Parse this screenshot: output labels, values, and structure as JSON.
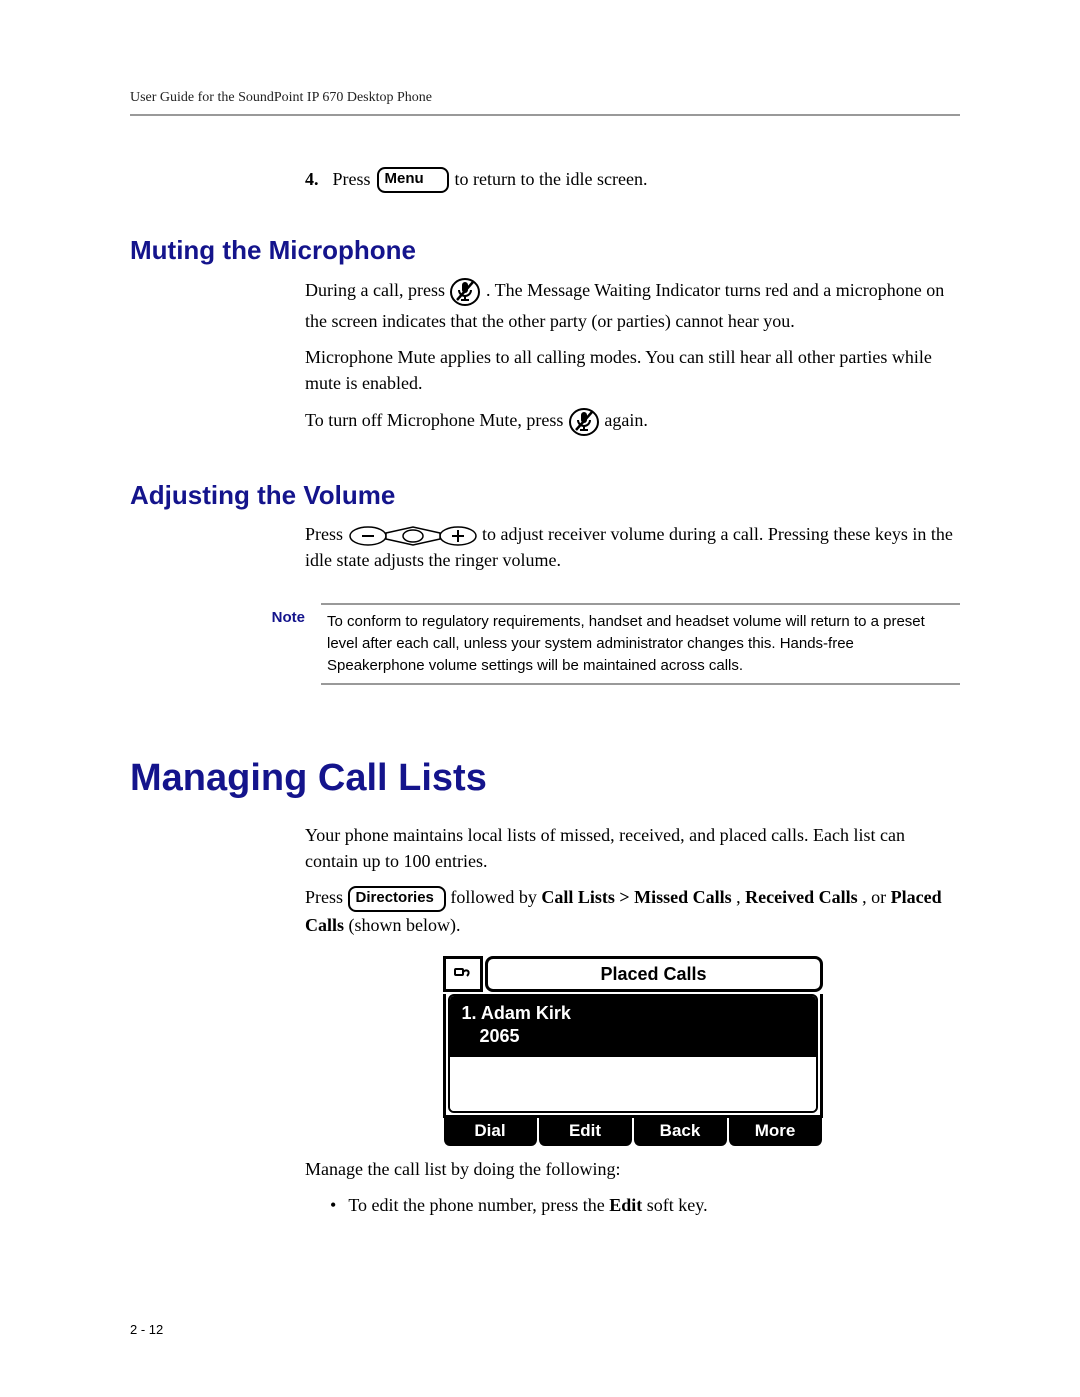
{
  "header": "User Guide for the SoundPoint IP 670 Desktop Phone",
  "step4": {
    "num": "4.",
    "t1": "Press",
    "btn": "Menu",
    "t2": "to return to the idle screen."
  },
  "sec_mute": {
    "title": "Muting the Microphone",
    "p1a": "During a call, press ",
    "p1b": " . The Message Waiting Indicator turns red and a microphone on the screen indicates that the other party (or parties) cannot hear you.",
    "p2": "Microphone Mute applies to all calling modes. You can still hear all other parties while mute is enabled.",
    "p3a": "To turn off Microphone Mute, press ",
    "p3b": " again."
  },
  "sec_vol": {
    "title": "Adjusting the Volume",
    "p1a": "Press ",
    "p1b": " to adjust receiver volume during a call. Pressing these keys in the idle state adjusts the ringer volume."
  },
  "note": {
    "label": "Note",
    "text": "To conform to regulatory requirements, handset and headset volume will return to a preset level after each call, unless your system administrator changes this. Hands-free Speakerphone volume settings will be maintained across calls."
  },
  "sec_lists": {
    "title": "Managing Call Lists",
    "p1": "Your phone maintains local lists of missed, received, and placed calls. Each list can contain up to 100 entries.",
    "p2a": "Press ",
    "btn": "Directories",
    "p2b": " followed by ",
    "p2c": "Call Lists > Missed Calls",
    "p2d": ", ",
    "p2e": "Received Calls",
    "p2f": ", or ",
    "p2g": "Placed Calls",
    "p2h": " (shown below).",
    "screen": {
      "title": "Placed Calls",
      "entry_line1": "1. Adam Kirk",
      "entry_line2": "2065",
      "keys": [
        "Dial",
        "Edit",
        "Back",
        "More"
      ]
    },
    "p3": "Manage the call list by doing the following:",
    "bullet1a": "To edit the phone number, press the ",
    "bullet1b": "Edit",
    "bullet1c": " soft key."
  },
  "pagenum": "2 - 12"
}
